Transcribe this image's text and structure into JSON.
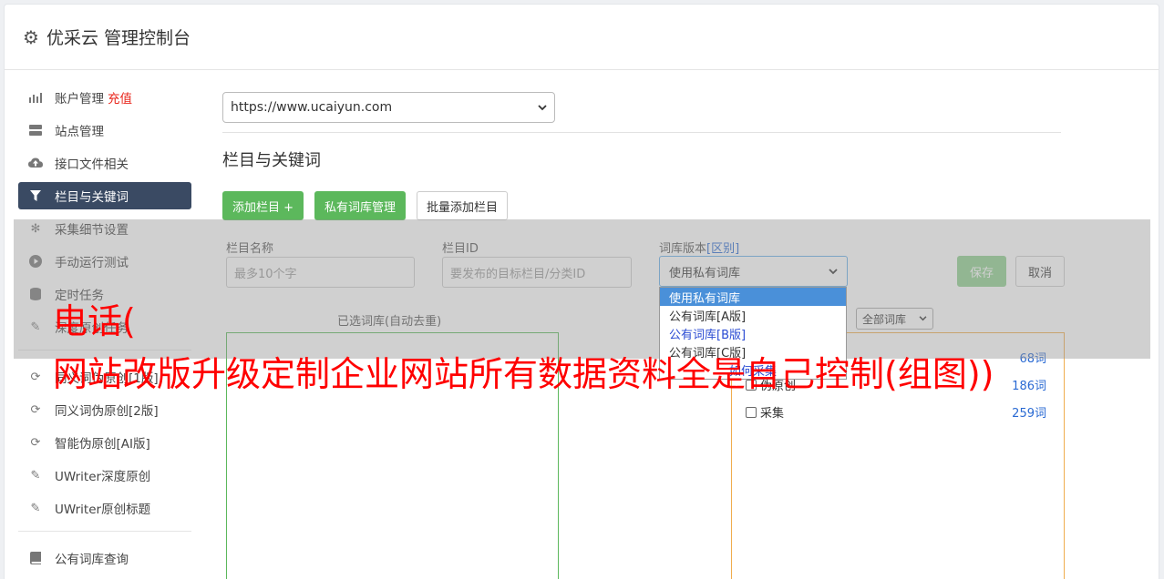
{
  "header": {
    "title": "优采云 管理控制台",
    "icon": "gear-icon"
  },
  "sidebar": {
    "items": [
      {
        "label": "账户管理",
        "badge": "充值",
        "icon": "bar-chart-icon"
      },
      {
        "label": "站点管理",
        "icon": "server-icon"
      },
      {
        "label": "接口文件相关",
        "icon": "cloud-upload-icon"
      },
      {
        "label": "栏目与关键词",
        "icon": "filter-icon",
        "active": true
      },
      {
        "label": "采集细节设置",
        "icon": "gears-icon"
      },
      {
        "label": "手动运行测试",
        "icon": "play-circle-icon"
      },
      {
        "label": "定时任务",
        "icon": "database-icon"
      },
      {
        "label": "深度原创任务",
        "icon": "edit-icon"
      },
      {
        "label": "同义词伪原创[1版]",
        "icon": "refresh-icon"
      },
      {
        "label": "同义词伪原创[2版]",
        "icon": "refresh-icon"
      },
      {
        "label": "智能伪原创[AI版]",
        "icon": "refresh-icon"
      },
      {
        "label": "UWriter深度原创",
        "icon": "edit-icon"
      },
      {
        "label": "UWriter原创标题",
        "icon": "edit-icon"
      },
      {
        "label": "公有词库查询",
        "icon": "book-icon"
      }
    ]
  },
  "main": {
    "site_select": {
      "value": "https://www.ucaiyun.com"
    },
    "section_title": "栏目与关键词",
    "buttons": {
      "add_column": "添加栏目 +",
      "private_lib": "私有词库管理",
      "batch_add": "批量添加栏目"
    }
  },
  "form": {
    "column_name": {
      "label": "栏目名称",
      "placeholder": "最多10个字"
    },
    "column_id": {
      "label": "栏目ID",
      "placeholder": "要发布的目标栏目/分类ID"
    },
    "lib_version": {
      "label": "词库版本",
      "diff_link": "[区别]",
      "value": "使用私有词库"
    },
    "dropdown_options": [
      "使用私有词库",
      "公有词库[A版]",
      "公有词库[B版]",
      "公有词库[C版]",
      "如何采集"
    ],
    "save": "保存",
    "cancel": "取消",
    "selected_libs_title": "已选词库(自动去重)",
    "all_libs_select": "全部词库",
    "lib_list": [
      {
        "name": "伪原创",
        "count": "186词"
      },
      {
        "name": "采集",
        "count": "259词"
      }
    ],
    "top_count": "68词"
  },
  "watermark": {
    "line1": "电话(",
    "line2": "网站改版升级定制企业网站所有数据资料全是自己控制(组图))"
  },
  "colors": {
    "accent_green": "#5cb85c",
    "active_nav": "#3a4a63",
    "link_blue": "#2a6ad3",
    "watermark": "#ff0000"
  }
}
